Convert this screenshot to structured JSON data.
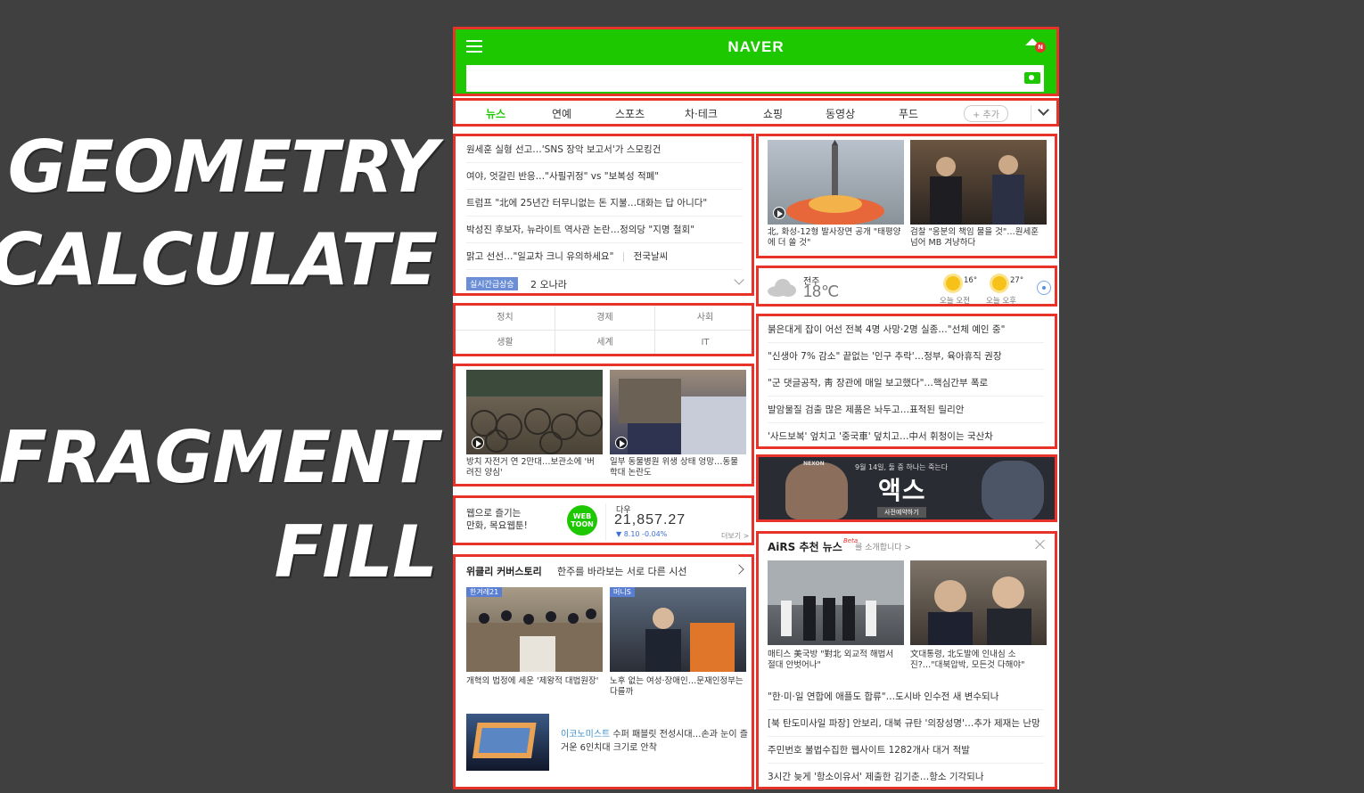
{
  "slogan": {
    "line1": "GEOMETRY",
    "line2": "CALCULATE",
    "line3": "FRAGMENT",
    "line4": "FILL"
  },
  "header": {
    "logo": "NAVER",
    "home_badge": "N",
    "search_placeholder": ""
  },
  "tabs": [
    "뉴스",
    "연예",
    "스포츠",
    "차·테크",
    "쇼핑",
    "동영상",
    "푸드"
  ],
  "add_tab": "+ 추가",
  "headlines": [
    "원세훈 실형 선고…'SNS 장악 보고서'가 스모킹건",
    "여야, 엇갈린 반응…\"사필귀정\" vs \"보복성 적폐\"",
    "트럼프 \"北에 25년간 터무니없는 돈 지불…대화는 답 아니다\"",
    "박성진 후보자, 뉴라이트 역사관 논란…정의당 \"지명 철회\"",
    "맑고 선선…\"일교차 크니 유의하세요\""
  ],
  "headline_extra": "전국날씨",
  "realtime": {
    "label": "실시간급상승",
    "item": "2 오나라"
  },
  "categories": [
    "정치",
    "경제",
    "사회",
    "생활",
    "세계",
    "IT"
  ],
  "videos": [
    {
      "caption": "방치 자전거 연 2만대…보관소에 '버려진 양심'"
    },
    {
      "caption": "일부 동물병원 위생 상태 엉망…동물 학대 논란도"
    }
  ],
  "webtoon": {
    "line1": "웹으로 즐기는",
    "line2": "만화, 목요웹툰!",
    "badge_top": "WEB",
    "badge_bottom": "TOON"
  },
  "stock": {
    "label": "다우",
    "value": "21,857.27",
    "change": "▼ 8.10 -0.04%",
    "more": "더보기 >"
  },
  "weekly": {
    "title": "위클리 커버스토리",
    "subtitle": "한주를 바라보는 서로 다른 시선",
    "items": [
      {
        "source": "한겨레21",
        "caption": "개혁의 법정에 세운 '제왕적 대법원장'"
      },
      {
        "source": "머니S",
        "caption": "노후 없는 여성·장애인…문재인정부는 다를까"
      }
    ],
    "economist_tag": "이코노미스트",
    "economist_text": "수퍼 패블릿 전성시대…손과 눈이 즐거운 6인치대 크기로 안착"
  },
  "top_images": [
    {
      "caption": "北, 화성-12형 발사장면 공개 \"태평양에 더 쏠 것\""
    },
    {
      "caption": "검찰 \"응분의 책임 물을 것\"…원세훈 넘어 MB 겨냥하다"
    }
  ],
  "weather": {
    "city": "전주",
    "temp": "18℃",
    "am_temp": "16°",
    "pm_temp": "27°",
    "am_label": "오늘 오전",
    "pm_label": "오늘 오후"
  },
  "headlines2": [
    "붉은대게 잡이 어선 전복 4명 사망·2명 실종…\"선체 예인 중\"",
    "\"신생아 7% 감소\" 끝없는 '인구 추락'…정부, 육아휴직 권장",
    "\"군 댓글공작, 靑 장관에 매일 보고했다\"…핵심간부 폭로",
    "발암물질 검출 많은 제품은 놔두고…표적된 릴리안",
    "'사드보복' 엎치고 '중국車' 덮치고…中서 휘청이는 국산차"
  ],
  "ad": {
    "brand": "NEXON",
    "date": "9월 14일, 둘 중 하나는 죽는다",
    "title": "액스",
    "button": "사전예약하기"
  },
  "airs": {
    "title": "AiRS 추천 뉴스",
    "beta": "Beta",
    "subtitle": "를 소개합니다 >",
    "items": [
      {
        "caption": "매티스 美국방 \"對北 외교적 해법서 절대 안벗어나\""
      },
      {
        "caption": "文대통령, 北도발에 인내심 소진?…\"대북압박, 모든것 다해야\""
      }
    ],
    "headlines": [
      "\"한·미·일 연합에 애플도 합류\"…도시바 인수전 새 변수되나",
      "[북 탄도미사일 파장] 안보리, 대북 규탄 '의장성명'…추가 제재는 난망",
      "주민번호 불법수집한 웹사이트 1282개사 대거 적발",
      "3시간 늦게 '항소이유서' 제출한 김기춘…항소 기각되나"
    ]
  },
  "colors": {
    "brand": "#1ec800",
    "highlight_border": "#e8332a",
    "background": "#404040"
  }
}
